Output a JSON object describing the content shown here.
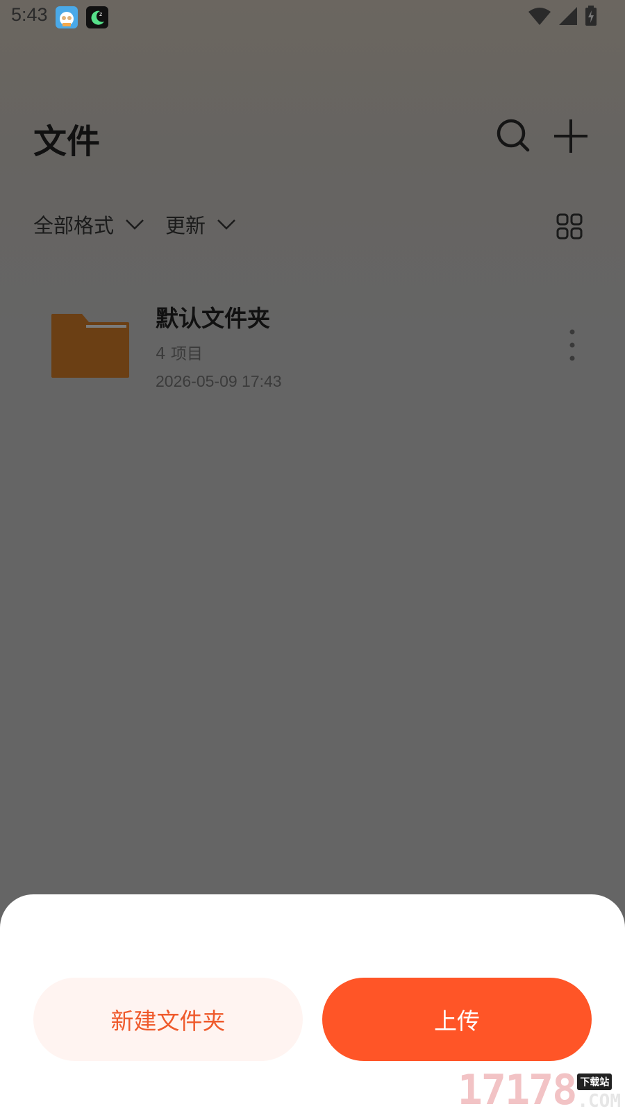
{
  "status_bar": {
    "time": "5:43",
    "icons": [
      "app-avatar-icon",
      "moon-app-icon",
      "wifi-icon",
      "cell-signal-icon",
      "battery-icon"
    ]
  },
  "header": {
    "title": "文件",
    "icons": [
      "search-icon",
      "plus-icon"
    ]
  },
  "filters": {
    "format_label": "全部格式",
    "sort_label": "更新",
    "view_icon": "grid-view-icon"
  },
  "folders": [
    {
      "name": "默认文件夹",
      "count": "4 项目",
      "date": "2026-05-09 17:43",
      "color": "#6b3f14"
    }
  ],
  "sheet": {
    "new_folder_label": "新建文件夹",
    "upload_label": "上传",
    "accent": "#ff5527"
  },
  "watermark": {
    "number": "17178",
    "tag": "下载站",
    "suffix": ".COM"
  }
}
